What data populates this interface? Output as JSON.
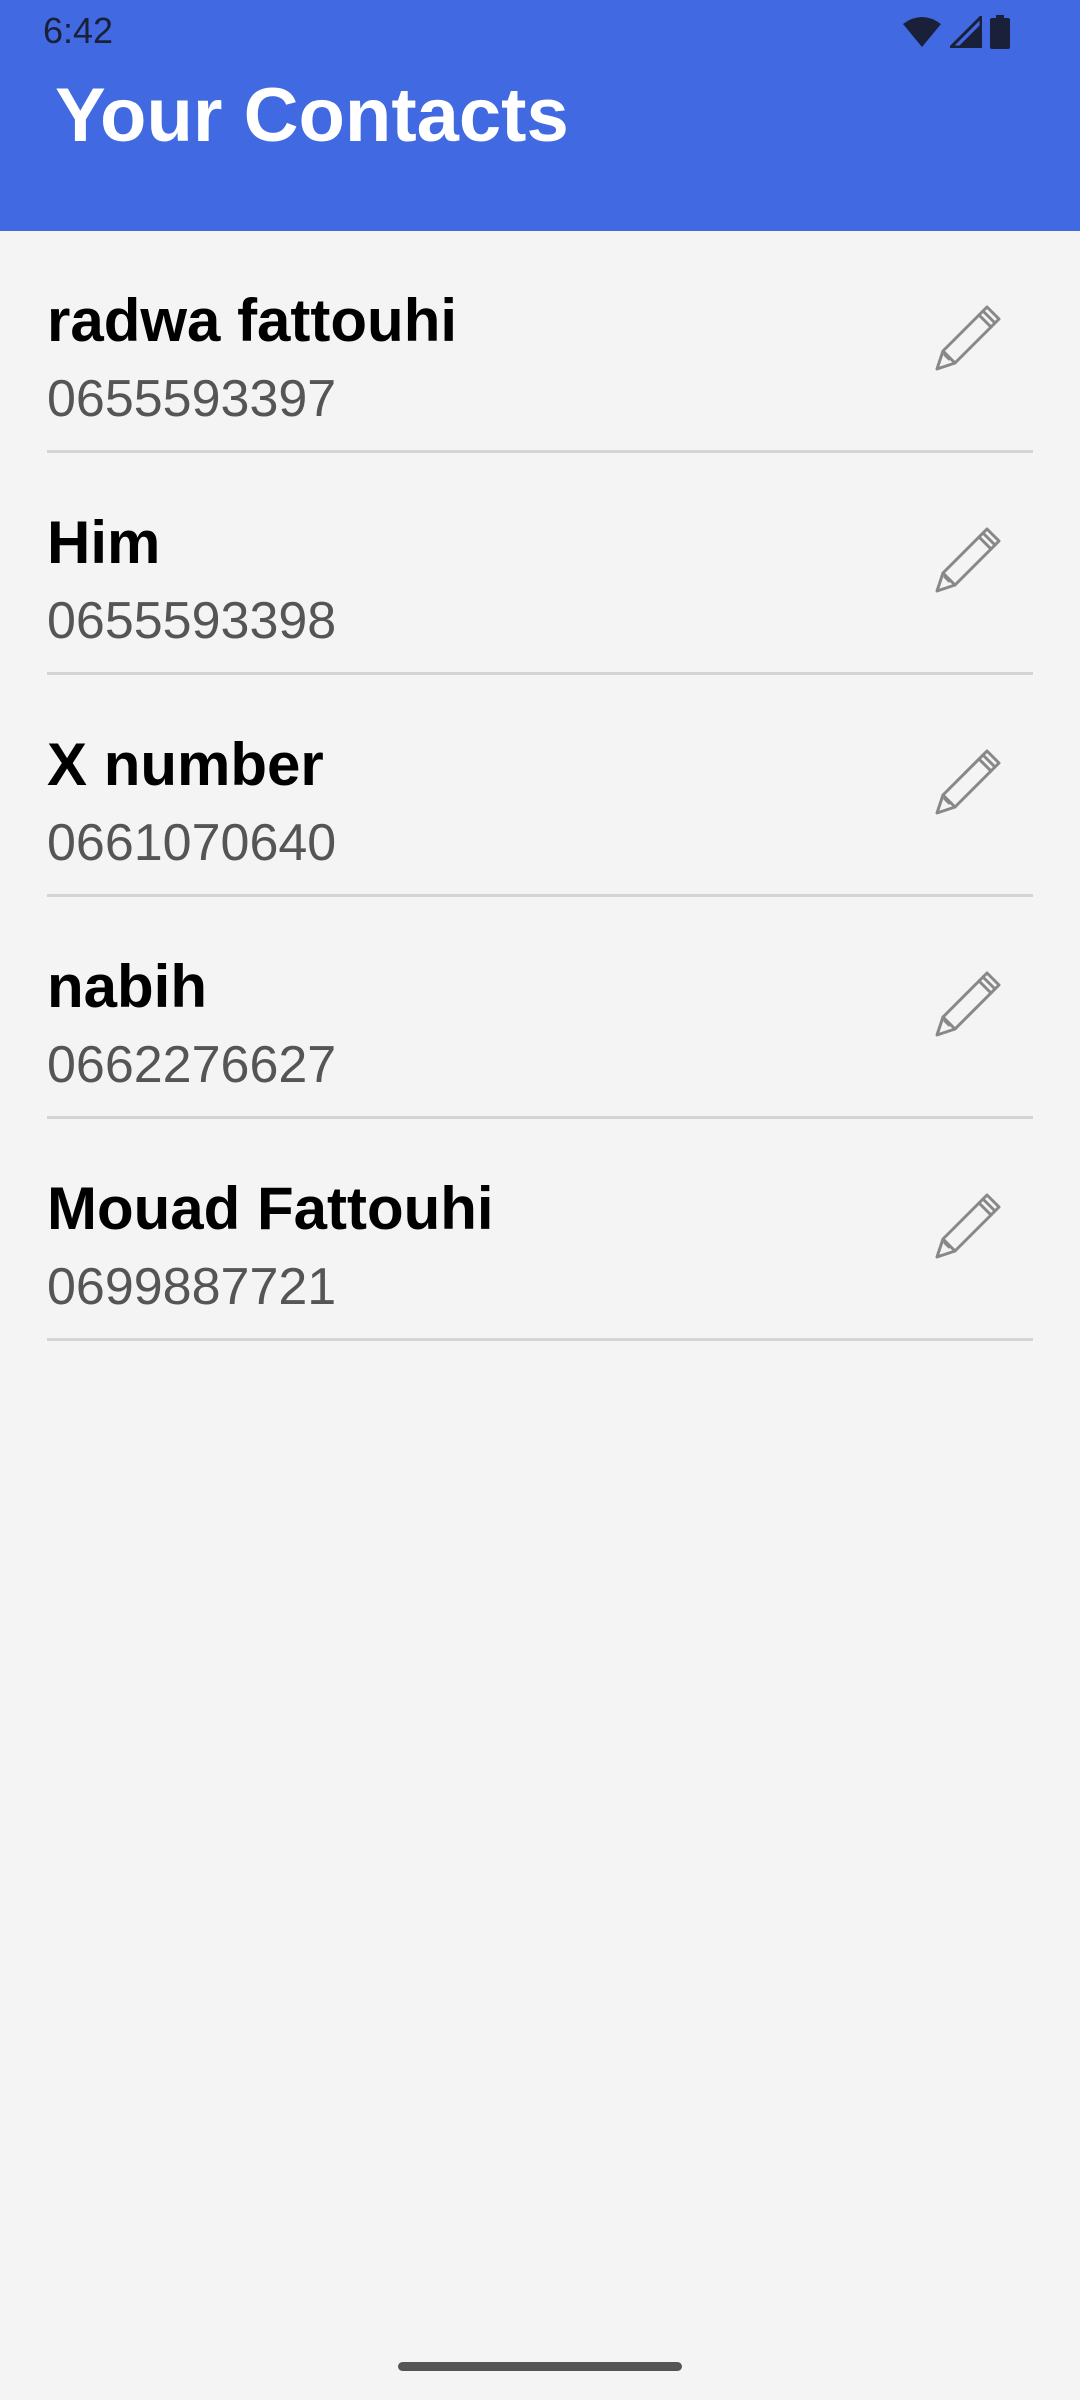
{
  "status_bar": {
    "time": "6:42",
    "icons": [
      "wifi-icon",
      "cellular-signal-icon",
      "battery-icon"
    ]
  },
  "header": {
    "title": "Your Contacts",
    "background_color": "#4169e1"
  },
  "contacts": [
    {
      "name": "radwa fattouhi",
      "phone": "0655593397",
      "action_icon": "pencil-icon"
    },
    {
      "name": "Him",
      "phone": "0655593398",
      "action_icon": "pencil-icon"
    },
    {
      "name": "X number",
      "phone": "0661070640",
      "action_icon": "pencil-icon"
    },
    {
      "name": "nabih",
      "phone": "0662276627",
      "action_icon": "pencil-icon"
    },
    {
      "name": "Mouad Fattouhi",
      "phone": "0699887721",
      "action_icon": "pencil-icon"
    }
  ]
}
